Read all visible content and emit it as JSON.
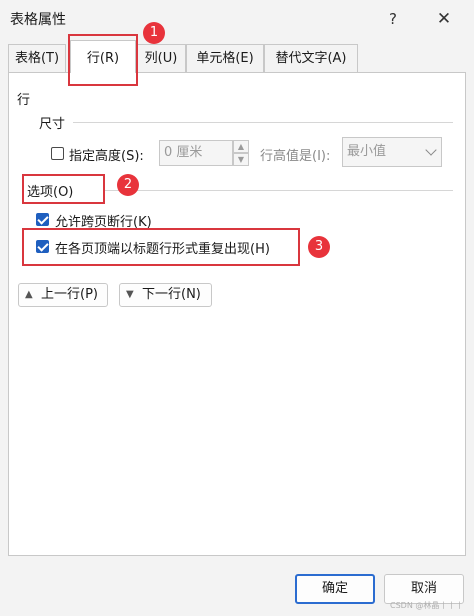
{
  "window": {
    "title": "表格属性",
    "help_label": "?",
    "close_label": "✕"
  },
  "tabs": [
    {
      "label": "表格(T)"
    },
    {
      "label": "行(R)"
    },
    {
      "label": "列(U)"
    },
    {
      "label": "单元格(E)"
    },
    {
      "label": "替代文字(A)"
    }
  ],
  "row_tab": {
    "section_label": "行",
    "size_label": "尺寸",
    "specify_height_label": "指定高度(S):",
    "specify_height_checked": false,
    "height_value": "0 厘米",
    "row_height_is_label": "行高值是(I):",
    "row_height_option": "最小值",
    "options_label": "选项(O)",
    "allow_break_label": "允许跨页断行(K)",
    "allow_break_checked": true,
    "repeat_header_label": "在各页顶端以标题行形式重复出现(H)",
    "repeat_header_checked": true,
    "prev_row_label": "上一行(P)",
    "next_row_label": "下一行(N)"
  },
  "annotations": {
    "badge1": "1",
    "badge2": "2",
    "badge3": "3"
  },
  "footer": {
    "ok_label": "确定",
    "cancel_label": "取消"
  },
  "watermark": "CSDN @林晶丨丨丨",
  "icons": {
    "up": "triangle-up-icon",
    "down": "triangle-down-icon",
    "close": "close-icon",
    "help": "help-icon"
  },
  "colors": {
    "accent": "#1f5fbf",
    "annotation_red": "#d9363e",
    "primary_button_border": "#2b6cd0"
  }
}
